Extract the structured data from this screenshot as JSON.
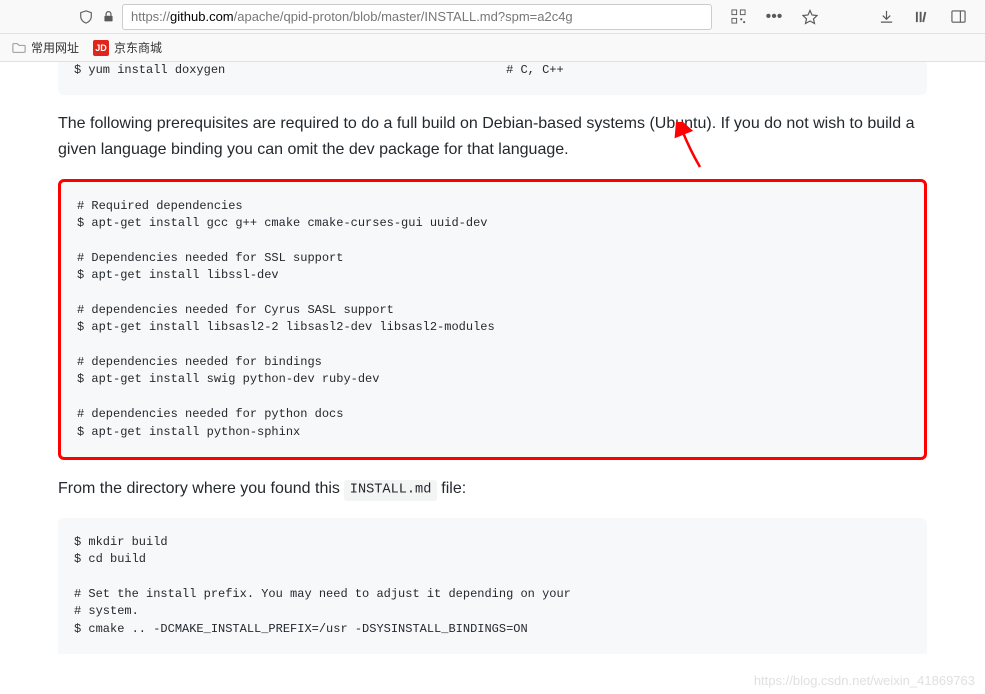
{
  "browser": {
    "url_protocol": "https://",
    "url_domain": "github.com",
    "url_path": "/apache/qpid-proton/blob/master/INSTALL.md?spm=a2c4g"
  },
  "bookmarks": {
    "item1": "常用网址",
    "item2_badge": "JD",
    "item2": "京东商城"
  },
  "code_top": "$ yum install doxygen                                       # C, C++",
  "paragraph1": "The following prerequisites are required to do a full build on Debian-based systems (Ubuntu). If you do not wish to build a given language binding you can omit the dev package for that language.",
  "code_highlighted": "# Required dependencies\n$ apt-get install gcc g++ cmake cmake-curses-gui uuid-dev\n\n# Dependencies needed for SSL support\n$ apt-get install libssl-dev\n\n# dependencies needed for Cyrus SASL support\n$ apt-get install libsasl2-2 libsasl2-dev libsasl2-modules\n\n# dependencies needed for bindings\n$ apt-get install swig python-dev ruby-dev\n\n# dependencies needed for python docs\n$ apt-get install python-sphinx",
  "paragraph2_before": "From the directory where you found this ",
  "paragraph2_code": "INSTALL.md",
  "paragraph2_after": " file:",
  "code_bottom": "$ mkdir build\n$ cd build\n\n# Set the install prefix. You may need to adjust it depending on your\n# system.\n$ cmake .. -DCMAKE_INSTALL_PREFIX=/usr -DSYSINSTALL_BINDINGS=ON",
  "watermark": "https://blog.csdn.net/weixin_41869763"
}
